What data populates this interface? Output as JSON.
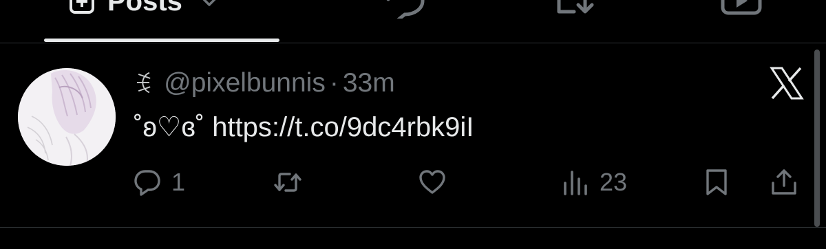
{
  "tabs": {
    "posts_label": "Posts",
    "active": "posts",
    "icons": [
      "post-icon",
      "replies-icon",
      "media-icon",
      "videos-icon"
    ]
  },
  "post": {
    "display_name": "ꉂ",
    "handle": "@pixelbunnis",
    "separator": "·",
    "timestamp": "33m",
    "text_prefix": "˚ʚ♡ɞ˚ ",
    "link": "https://t.co/9dc4rbk9iI",
    "source_icon": "x-logo-icon",
    "actions": {
      "reply_count": "1",
      "repost_count": "",
      "like_count": "",
      "views_count": "23"
    }
  },
  "colors": {
    "background": "#000000",
    "text_primary": "#e7e9ea",
    "text_secondary": "#71767b",
    "divider": "#2f3336"
  }
}
